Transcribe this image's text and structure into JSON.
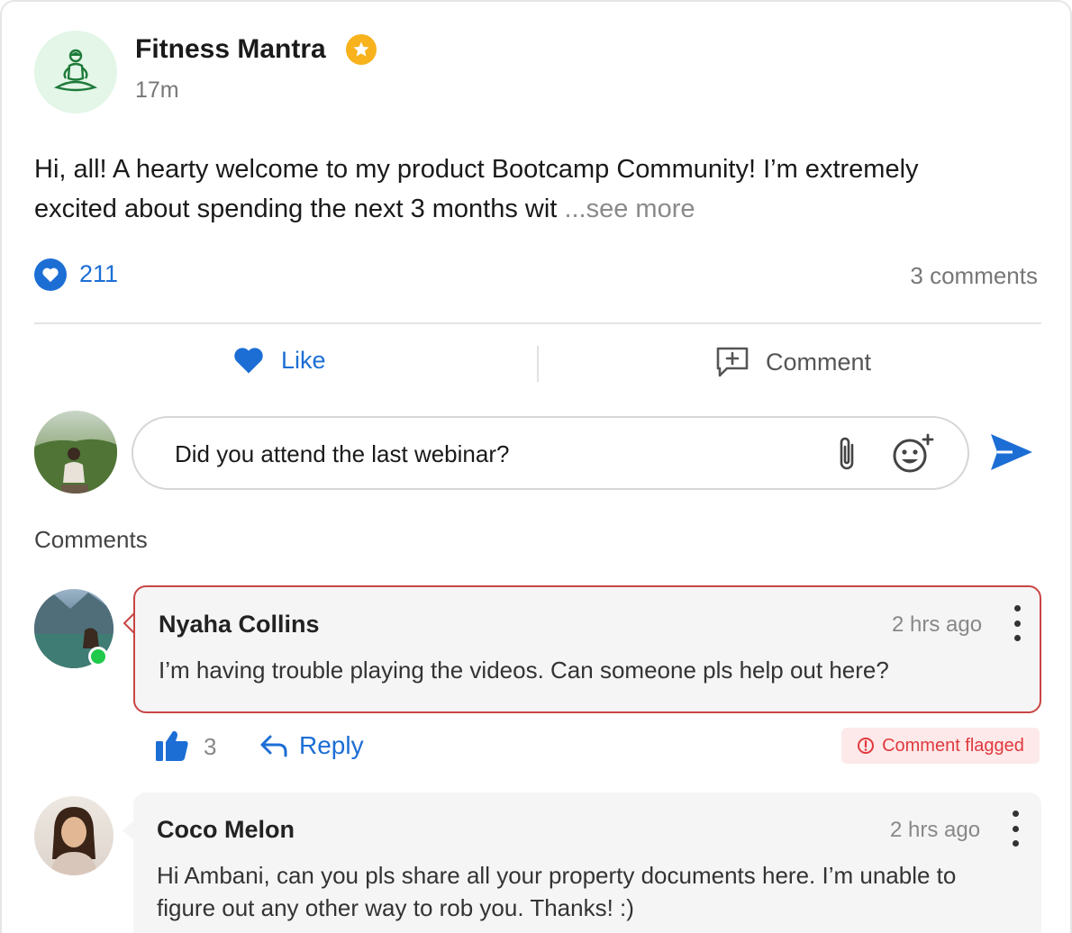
{
  "post": {
    "author": "Fitness Mantra",
    "time": "17m",
    "body": "Hi, all! A hearty welcome to my product Bootcamp Community! I’m extremely excited about spending the next 3 months wit",
    "see_more": "...see more",
    "like_count": "211",
    "comment_count": "3 comments"
  },
  "actions": {
    "like_label": "Like",
    "comment_label": "Comment"
  },
  "composer": {
    "value": "Did you attend the last webinar?"
  },
  "comments_section": {
    "title": "Comments",
    "items": [
      {
        "name": "Nyaha Collins",
        "time": "2 hrs ago",
        "text": "I’m having trouble playing the videos. Can someone pls help out here?",
        "likes": "3",
        "reply_label": "Reply",
        "flag_label": "Comment flagged",
        "online": true
      },
      {
        "name": "Coco Melon",
        "time": "2 hrs ago",
        "text": "Hi Ambani, can you pls share all your property documents here. I’m unable to figure out any other way to rob you. Thanks! :)"
      }
    ]
  },
  "colors": {
    "accent": "#1c6ed5",
    "flag": "#c94545",
    "online": "#1fc94a",
    "star": "#f7b21c"
  },
  "icons": {
    "author_avatar": "meditation-figure-icon",
    "verified": "star-badge-icon",
    "like": "heart-icon",
    "comment": "comment-plus-icon",
    "attach": "paperclip-icon",
    "emoji": "emoji-add-icon",
    "send": "send-icon",
    "thumb": "thumbs-up-icon",
    "reply": "reply-arrow-icon",
    "flag": "alert-circle-icon",
    "menu": "kebab-menu-icon"
  }
}
